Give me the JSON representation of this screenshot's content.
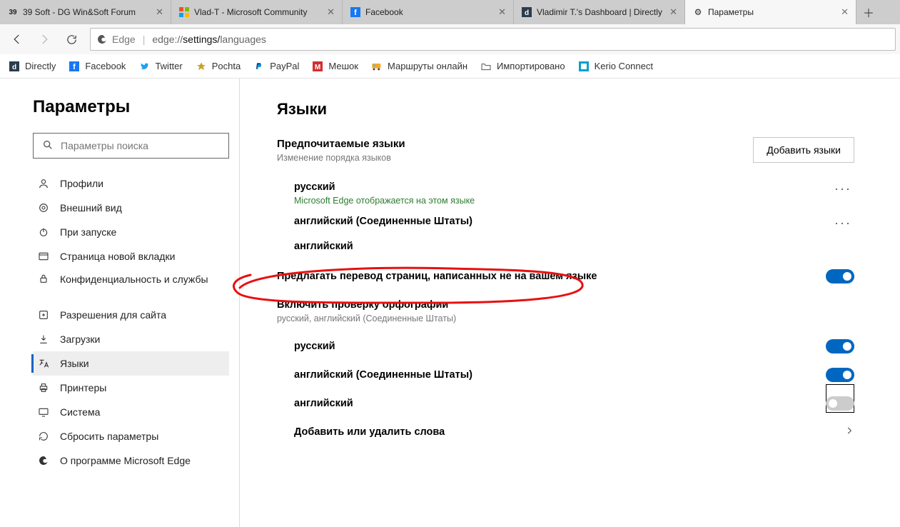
{
  "tabs": [
    {
      "title": "39 Soft - DG Win&Soft Forum"
    },
    {
      "title": "Vlad-T - Microsoft Community"
    },
    {
      "title": "Facebook"
    },
    {
      "title": "Vladimir T.'s Dashboard | Directly"
    },
    {
      "title": "Параметры"
    }
  ],
  "address": {
    "app": "Edge",
    "proto": "edge://",
    "path1": "settings/",
    "path2": "languages"
  },
  "bookmarks": [
    "Directly",
    "Facebook",
    "Twitter",
    "Pochta",
    "PayPal",
    "Мешок",
    "Маршруты онлайн",
    "Импортировано",
    "Kerio Connect"
  ],
  "sidebar": {
    "title": "Параметры",
    "search_placeholder": "Параметры поиска",
    "items": [
      "Профили",
      "Внешний вид",
      "При запуске",
      "Страница новой вкладки",
      "Конфиденциальность и службы",
      "Разрешения для сайта",
      "Загрузки",
      "Языки",
      "Принтеры",
      "Система",
      "Сбросить параметры",
      "О программе Microsoft Edge"
    ]
  },
  "main": {
    "heading": "Языки",
    "pref_title": "Предпочитаемые языки",
    "pref_hint": "Изменение порядка языков",
    "add_button": "Добавить языки",
    "langs": [
      {
        "name": "русский",
        "sub": "Microsoft Edge отображается на этом языке"
      },
      {
        "name": "английский (Соединенные Штаты)"
      },
      {
        "name": "английский"
      }
    ],
    "translate_title": "Предлагать перевод страниц, написанных не на вашем языке",
    "spell_title": "Включить проверку орфографии",
    "spell_hint": "русский, английский (Соединенные Штаты)",
    "spell_langs": [
      "русский",
      "английский (Соединенные Штаты)",
      "английский"
    ],
    "spell_add": "Добавить или удалить слова"
  }
}
